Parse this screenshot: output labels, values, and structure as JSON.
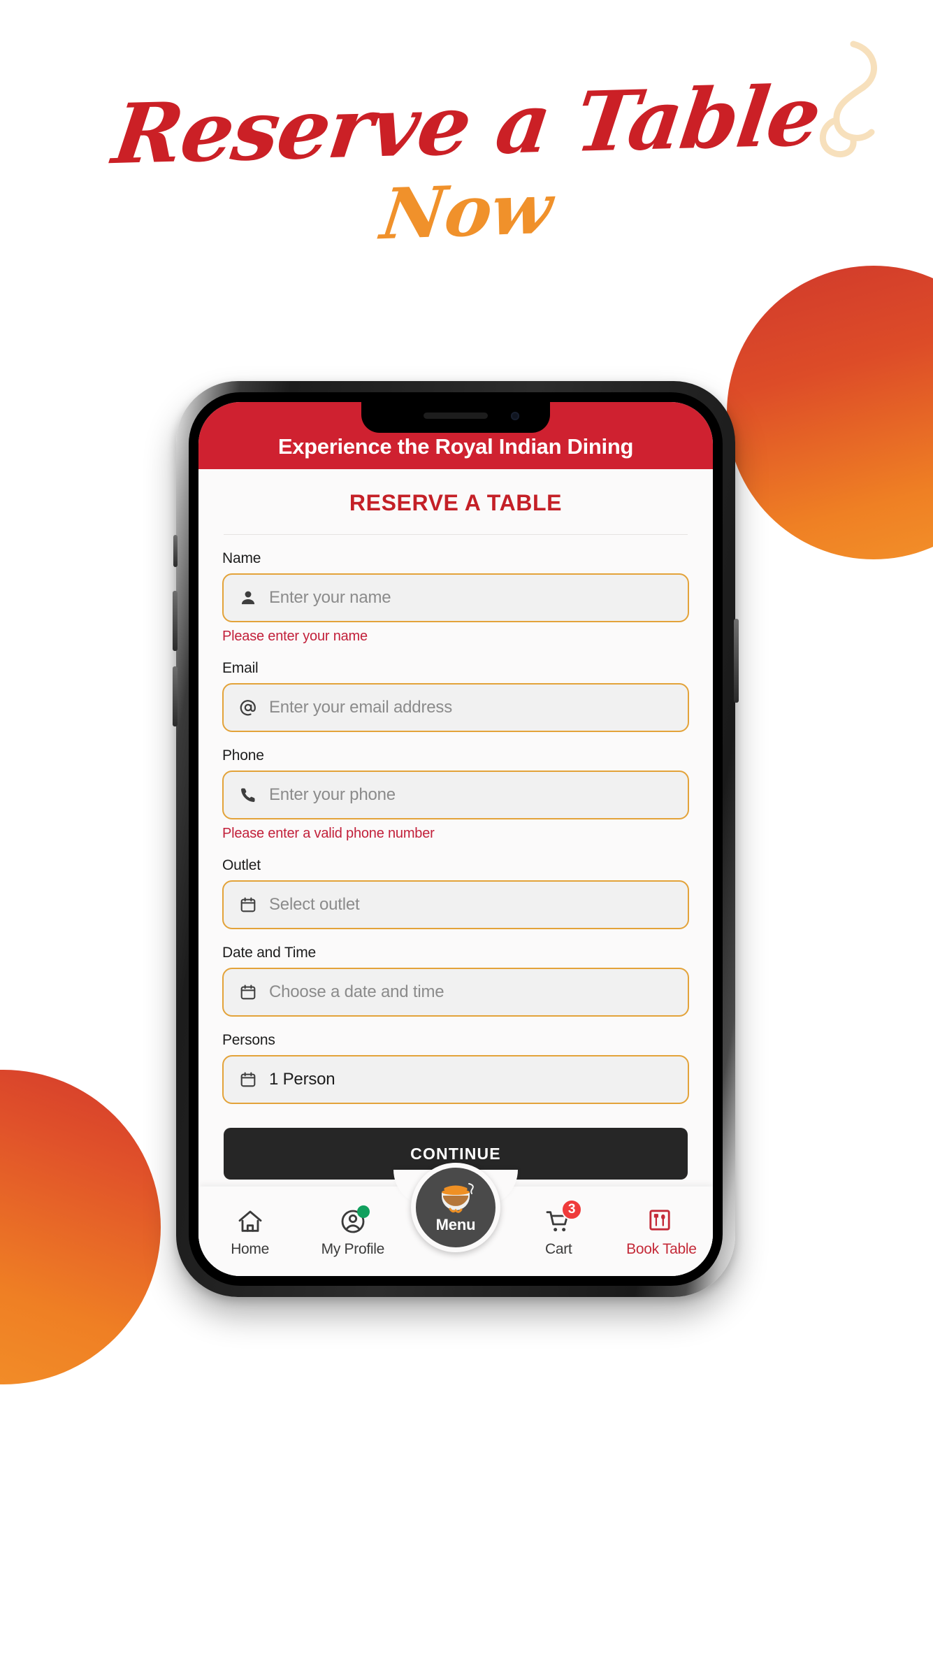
{
  "poster": {
    "headline_line1": "Reserve a Table",
    "headline_line2": "Now",
    "headline_color_1": "#cb2026",
    "headline_color_2": "#f0912b",
    "swirl_color": "#f7e0bc",
    "decor_circle_top": "#d3392c",
    "decor_circle_bottom": "#f3932a",
    "background": "#ffffff"
  },
  "app": {
    "header": {
      "title": "Experience the Royal Indian Dining",
      "background": "#cf2130",
      "text_color": "#ffffff"
    },
    "form": {
      "title": "RESERVE A TABLE",
      "title_color": "#c42027",
      "border_color": "#e3a33a",
      "error_color": "#c2203a",
      "fields": [
        {
          "label": "Name",
          "icon": "person-icon",
          "value": "",
          "placeholder": "Enter your name",
          "error": "Please enter your name"
        },
        {
          "label": "Email",
          "icon": "at-sign-icon",
          "value": "",
          "placeholder": "Enter your email address",
          "error": ""
        },
        {
          "label": "Phone",
          "icon": "phone-icon",
          "value": "",
          "placeholder": "Enter your phone",
          "error": "Please enter a valid phone number"
        },
        {
          "label": "Outlet",
          "icon": "calendar-icon",
          "value": "",
          "placeholder": "Select outlet",
          "error": ""
        },
        {
          "label": "Date and Time",
          "icon": "calendar-icon",
          "value": "",
          "placeholder": "Choose a date and time",
          "error": ""
        },
        {
          "label": "Persons",
          "icon": "calendar-icon",
          "value": "1 Person",
          "placeholder": "",
          "error": ""
        }
      ],
      "submit_label": "CONTINUE",
      "submit_background": "#262626"
    },
    "bottom_nav": {
      "items": [
        {
          "label": "Home",
          "icon": "home-icon",
          "active": false,
          "badge": "",
          "badge_type": "none"
        },
        {
          "label": "My Profile",
          "icon": "user-circle-icon",
          "active": false,
          "badge": "",
          "badge_type": "dot"
        },
        {
          "label": "Cart",
          "icon": "cart-icon",
          "active": false,
          "badge": "3",
          "badge_type": "count"
        },
        {
          "label": "Book Table",
          "icon": "cutlery-box-icon",
          "active": true,
          "badge": "",
          "badge_type": "none"
        }
      ],
      "fab": {
        "label": "Menu",
        "icon": "biryani-pot-logo",
        "background": "#4a4a4a"
      },
      "badge_dot_color": "#12a05e",
      "badge_count_color": "#ef3b3b",
      "active_color": "#c42a38"
    }
  }
}
